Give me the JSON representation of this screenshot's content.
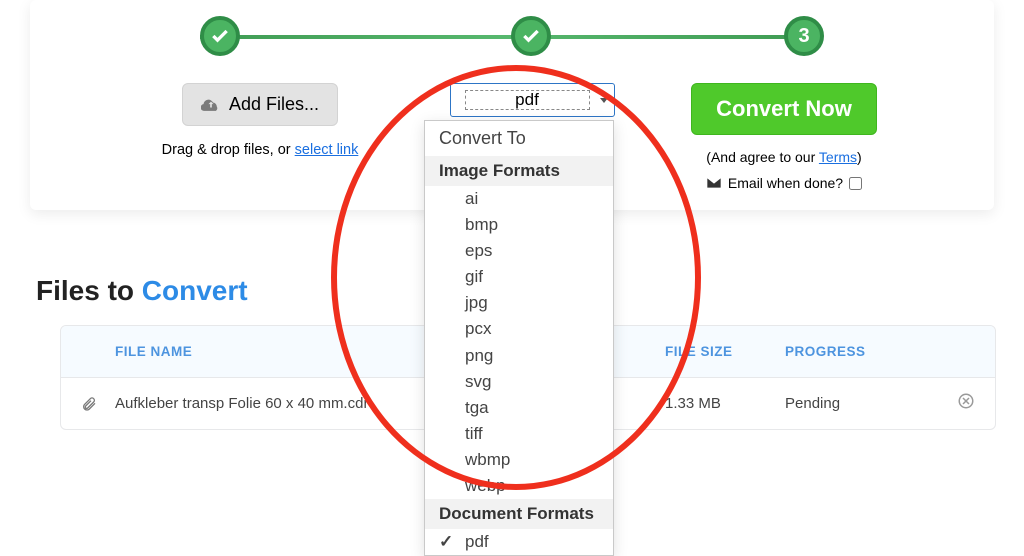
{
  "steps": {
    "third_number": "3"
  },
  "add_files": {
    "label": "Add Files...",
    "hint_prefix": "Drag & drop files, or ",
    "hint_link": "select link"
  },
  "format_select": {
    "selected": "pdf",
    "header": "Convert To",
    "group_image": "Image Formats",
    "image_formats": [
      "ai",
      "bmp",
      "eps",
      "gif",
      "jpg",
      "pcx",
      "png",
      "svg",
      "tga",
      "tiff",
      "wbmp",
      "webp"
    ],
    "group_document": "Document Formats",
    "document_formats": [
      "pdf"
    ]
  },
  "convert": {
    "label": "Convert Now",
    "agree_prefix": "(And agree to our ",
    "agree_link": "Terms",
    "agree_suffix": ")",
    "email_label": "Email when done?"
  },
  "files_section": {
    "title_plain": "Files to ",
    "title_accent": "Convert"
  },
  "table": {
    "headers": {
      "name": "FILE NAME",
      "size": "FILE SIZE",
      "progress": "PROGRESS"
    },
    "rows": [
      {
        "name": "Aufkleber transp Folie 60 x 40 mm.cdr",
        "size": "1.33 MB",
        "progress": "Pending"
      }
    ]
  }
}
